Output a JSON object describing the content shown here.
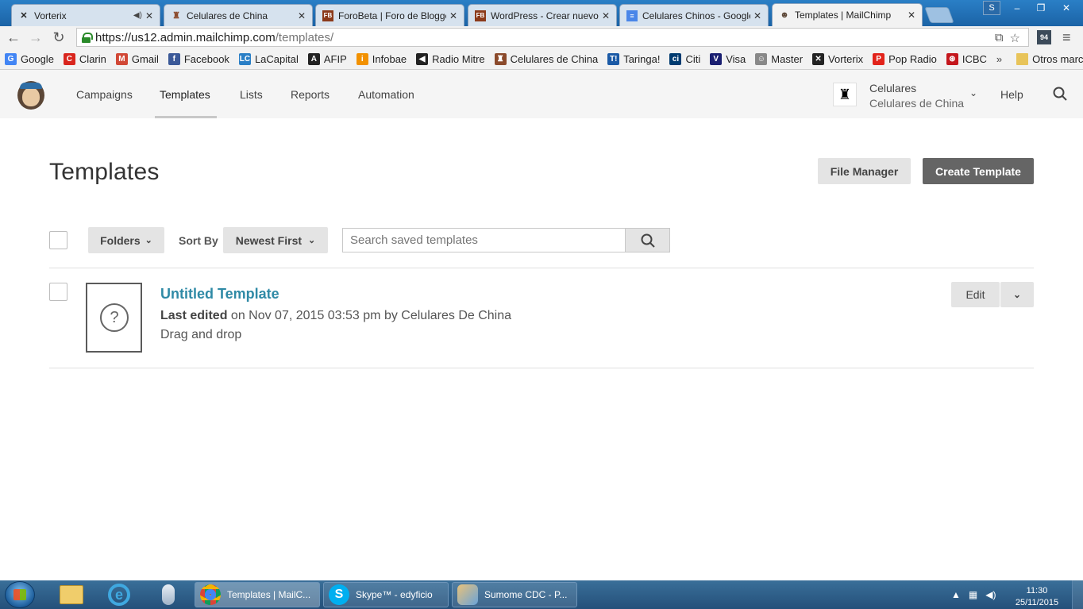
{
  "browser": {
    "tabs": [
      {
        "title": "Vorterix",
        "icon": "vorterix-icon",
        "muted": true
      },
      {
        "title": "Celulares de China",
        "icon": "celulares-icon"
      },
      {
        "title": "ForoBeta | Foro de Blogge",
        "icon": "forobeta-icon",
        "fav_text": "FB"
      },
      {
        "title": "WordPress - Crear nuevo",
        "icon": "forobeta-icon",
        "fav_text": "FB"
      },
      {
        "title": "Celulares Chinos - Google",
        "icon": "google-docs-icon"
      },
      {
        "title": "Templates | MailChimp",
        "icon": "mailchimp-icon",
        "active": true
      }
    ],
    "window_controls": {
      "user": "S",
      "minimize": "–",
      "maximize": "❐",
      "close": "✕"
    },
    "url_host": "https://us12.admin.mailchimp.com",
    "url_path": "/templates/",
    "extension_badge": "94",
    "bookmarks": [
      {
        "label": "Google",
        "icon": "google-icon",
        "color": "#4285f4",
        "glyph": "G"
      },
      {
        "label": "Clarin",
        "icon": "clarin-icon",
        "color": "#d9251d",
        "glyph": "C"
      },
      {
        "label": "Gmail",
        "icon": "gmail-icon",
        "color": "#d14836",
        "glyph": "M"
      },
      {
        "label": "Facebook",
        "icon": "facebook-icon",
        "color": "#3b5998",
        "glyph": "f"
      },
      {
        "label": "LaCapital",
        "icon": "lacapital-icon",
        "color": "#2a7fc6",
        "glyph": "LC"
      },
      {
        "label": "AFIP",
        "icon": "afip-icon",
        "color": "#222222",
        "glyph": "A"
      },
      {
        "label": "Infobae",
        "icon": "infobae-icon",
        "color": "#f29100",
        "glyph": "i"
      },
      {
        "label": "Radio Mitre",
        "icon": "radio-mitre-icon",
        "color": "#222222",
        "glyph": "◀"
      },
      {
        "label": "Celulares de China",
        "icon": "celulares-icon",
        "color": "#8b4a2b",
        "glyph": "♜"
      },
      {
        "label": "Taringa!",
        "icon": "taringa-icon",
        "color": "#1b5aa6",
        "glyph": "T!"
      },
      {
        "label": "Citi",
        "icon": "citi-icon",
        "color": "#003b70",
        "glyph": "ci"
      },
      {
        "label": "Visa",
        "icon": "visa-icon",
        "color": "#1a1f71",
        "glyph": "V"
      },
      {
        "label": "Master",
        "icon": "master-icon",
        "color": "#888888",
        "glyph": "☺"
      },
      {
        "label": "Vorterix",
        "icon": "vorterix-icon",
        "color": "#222222",
        "glyph": "✕"
      },
      {
        "label": "Pop Radio",
        "icon": "pop-radio-icon",
        "color": "#e2231a",
        "glyph": "P"
      },
      {
        "label": "ICBC",
        "icon": "icbc-icon",
        "color": "#c4161c",
        "glyph": "⊛"
      }
    ],
    "bookmarks_more": "»",
    "other_bookmarks": "Otros marcadores"
  },
  "app": {
    "nav": {
      "campaigns": "Campaigns",
      "templates": "Templates",
      "lists": "Lists",
      "reports": "Reports",
      "automation": "Automation"
    },
    "account": {
      "name": "Celulares",
      "org": "Celulares de China"
    },
    "help": "Help",
    "page_title": "Templates",
    "file_manager": "File Manager",
    "create_template": "Create Template",
    "folders": "Folders",
    "sort_by_label": "Sort By",
    "sort_value": "Newest First",
    "search_placeholder": "Search saved templates",
    "templates": [
      {
        "name": "Untitled Template",
        "last_edited_label": "Last edited",
        "meta": " on Nov 07, 2015 03:53 pm by Celulares De China",
        "type": "Drag and drop",
        "edit": "Edit"
      }
    ]
  },
  "taskbar": {
    "tasks": [
      {
        "label": "Templates | MailC...",
        "icon": "chrome-icon",
        "active": true
      },
      {
        "label": "Skype™ - edyficio",
        "icon": "skype-icon"
      },
      {
        "label": "Sumome CDC - P...",
        "icon": "paint-icon"
      }
    ],
    "time": "11:30",
    "date": "25/11/2015"
  }
}
